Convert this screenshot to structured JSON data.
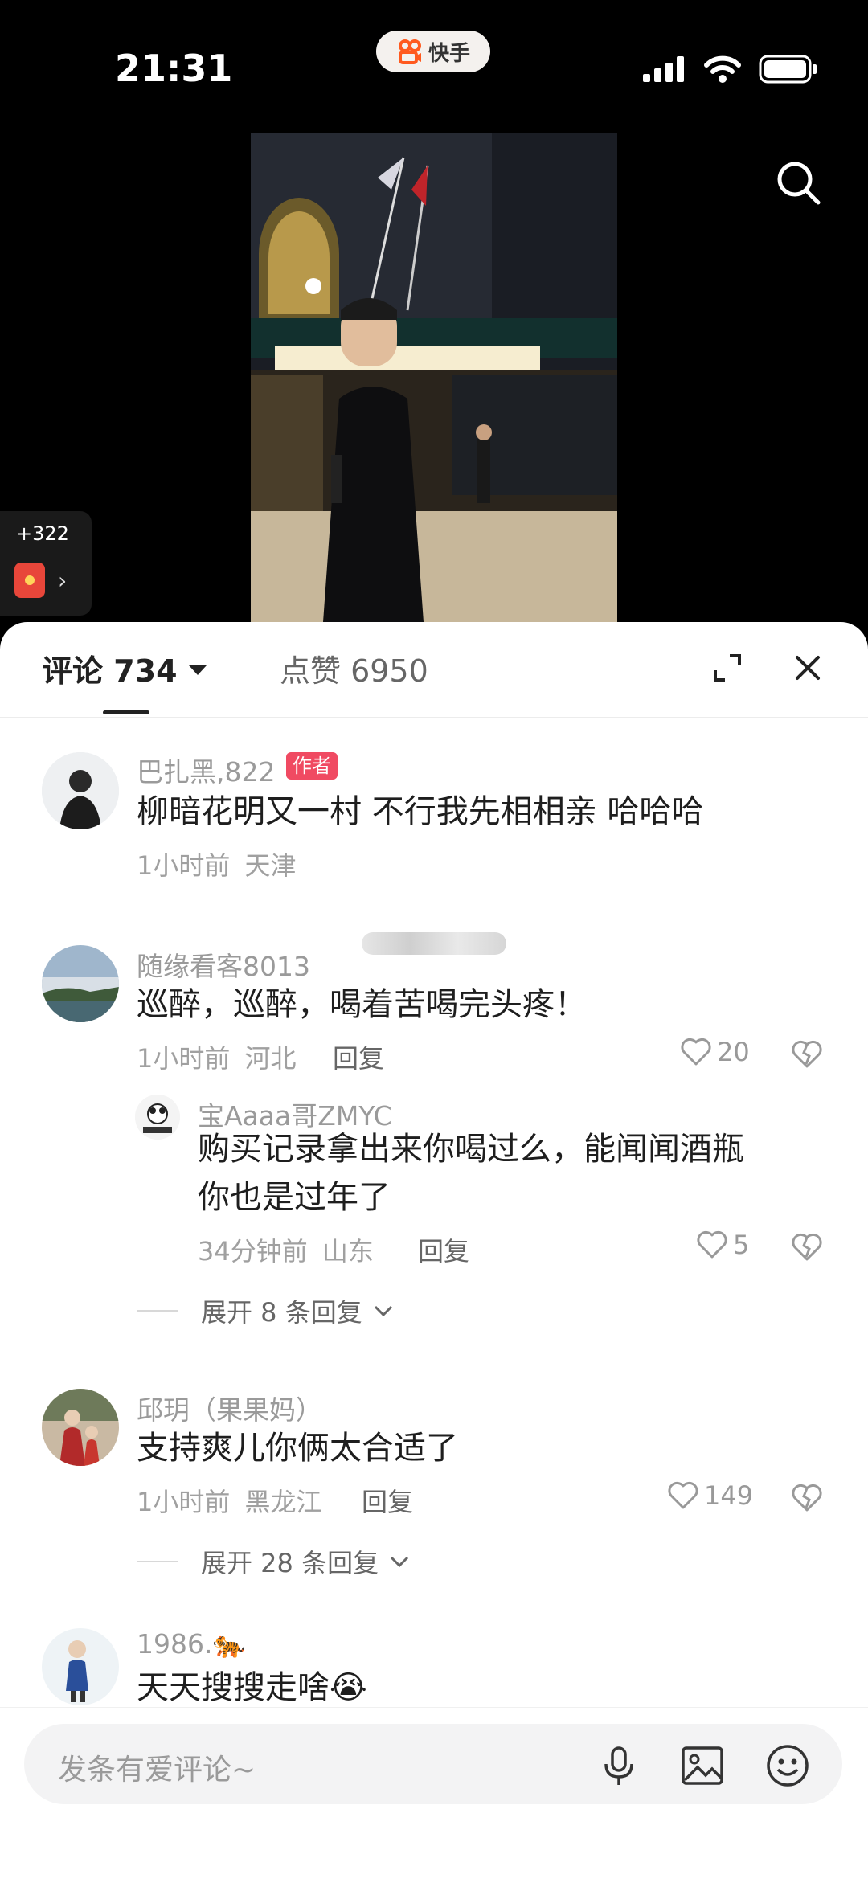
{
  "status": {
    "time": "21:31",
    "app_name": "快手"
  },
  "reward": {
    "count": "+322"
  },
  "sheet": {
    "tab_comments": "评论 734",
    "tab_likes": "点赞 6950"
  },
  "comments": [
    {
      "user": "巴扎黑,822",
      "badge": "作者",
      "text": "柳暗花明又一村 不行我先相相亲 哈哈哈",
      "time": "1小时前",
      "location": "天津"
    },
    {
      "user": "随缘看客8013",
      "text": "巡醉，巡醉，喝着苦喝完头疼！",
      "time": "1小时前",
      "location": "河北",
      "reply_label": "回复",
      "likes": "20"
    },
    {
      "user": "宝Aaaa哥ZMYC",
      "text_line1": "购买记录拿出来你喝过么，能闻闻酒瓶",
      "text_line2": "你也是过年了",
      "time": "34分钟前",
      "location": "山东",
      "reply_label": "回复",
      "likes": "5"
    },
    {
      "user": "邱玥（果果妈）",
      "text": "支持爽儿你俩太合适了",
      "time": "1小时前",
      "location": "黑龙江",
      "reply_label": "回复",
      "likes": "149"
    },
    {
      "user": "1986.🐅",
      "text": "天天搜搜走啥😭"
    }
  ],
  "expand1": "展开 8 条回复",
  "expand2": "展开 28 条回复",
  "input": {
    "placeholder": "发条有爱评论~"
  },
  "colors": {
    "author_badge": "#f04a62",
    "sheet_bg": "#ffffff",
    "screen_bg": "#000000"
  }
}
